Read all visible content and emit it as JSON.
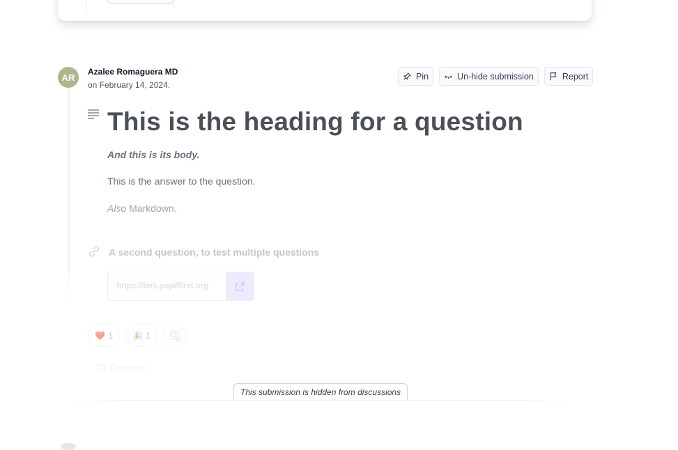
{
  "submission": {
    "author": {
      "initials": "AR",
      "name": "Azalee Romaguera MD",
      "date": "on February 14, 2024."
    },
    "actions": {
      "pin": "Pin",
      "unhide": "Un-hide submission",
      "report": "Report"
    },
    "question": {
      "heading": "This is the heading for a question",
      "body_italic": "And this is its body.",
      "answer": "This is the answer to the question.",
      "also_word": "Also",
      "markdown_word": " Markdown."
    },
    "second_question": {
      "label": "A second question, to test multiple questions",
      "url": "https://lms.pupilfirst.org"
    },
    "reactions": [
      {
        "emoji": "❤️",
        "count": "1"
      },
      {
        "emoji": "🎉",
        "count": "1"
      }
    ],
    "comment_label": "Comment",
    "hidden_notice": "This submission is hidden from discussions"
  },
  "colors": {
    "avatar_bg": "#b1b58e",
    "link_accent": "#ecebfd"
  }
}
